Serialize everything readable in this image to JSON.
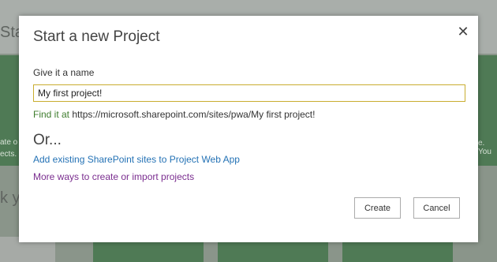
{
  "background": {
    "title_fragment": "Star",
    "left_text": [
      "ate o",
      "ects."
    ],
    "right_text": "e. You",
    "bottom_text": "k yo"
  },
  "dialog": {
    "title": "Start a new Project",
    "close_icon": "close-icon",
    "name_label": "Give it a name",
    "name_value": "My first project!",
    "find_prefix": "Find it at",
    "find_url": "https://microsoft.sharepoint.com/sites/pwa/My first project!",
    "or_text": "Or...",
    "link_add_existing": "Add existing SharePoint sites to Project Web App",
    "link_more_ways": "More ways to create or import projects",
    "create_label": "Create",
    "cancel_label": "Cancel"
  },
  "colors": {
    "accent_green": "#3f7d2e",
    "link_blue": "#2472b5",
    "link_purple": "#7a2d8f",
    "input_border": "#c9ad2f"
  }
}
